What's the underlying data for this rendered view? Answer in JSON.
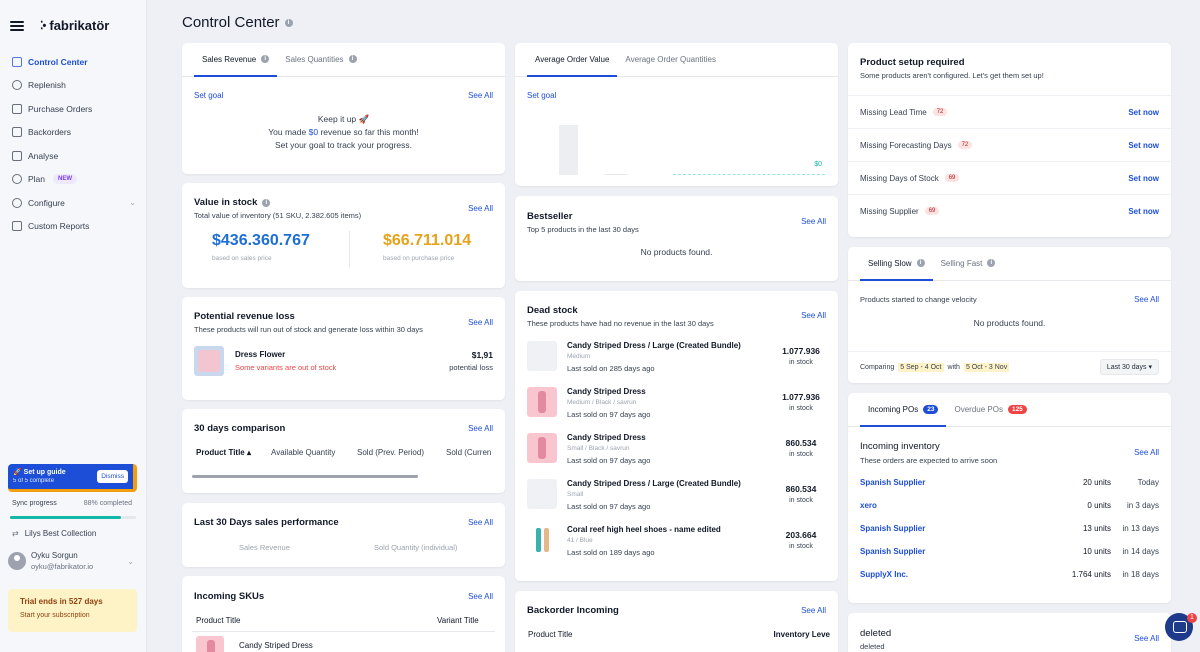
{
  "sidebar": {
    "brand": "fabrikatör",
    "items": [
      {
        "label": "Control Center",
        "active": true
      },
      {
        "label": "Replenish"
      },
      {
        "label": "Purchase Orders"
      },
      {
        "label": "Backorders"
      },
      {
        "label": "Analyse"
      },
      {
        "label": "Plan",
        "badge": "NEW"
      },
      {
        "label": "Configure"
      },
      {
        "label": "Custom Reports"
      }
    ],
    "setup_guide": {
      "title": "Set up guide",
      "subtitle": "5 of 5 complete",
      "dismiss": "Dismiss"
    },
    "sync": {
      "label": "Sync progress",
      "pct_text": "88% completed",
      "pct": 0.88
    },
    "store": "Lilys Best Collection",
    "user": {
      "name": "Oyku Sorgun",
      "email": "oyku@fabrikator.io"
    },
    "trial": {
      "title": "Trial ends in 527 days",
      "cta": "Start your subscription"
    }
  },
  "page": {
    "title": "Control Center"
  },
  "revenue": {
    "tabs": [
      "Sales Revenue",
      "Sales Quantities"
    ],
    "set_goal": "Set goal",
    "see_all": "See All",
    "line1": "Keep it up 🚀",
    "line2_pre": "You made ",
    "line2_val": "$0",
    "line2_post": " revenue so far this month!",
    "line3": "Set your goal to track your progress."
  },
  "value_stock": {
    "title": "Value in stock",
    "subtitle": "Total value of inventory (51 SKU, 2.382.605 items)",
    "see_all": "See All",
    "sales_value": "$436.360.767",
    "sales_caption": "based on sales price",
    "purchase_value": "$66.711.014",
    "purchase_caption": "based on purchase price"
  },
  "revenue_loss": {
    "title": "Potential revenue loss",
    "subtitle": "These products will run out of stock and generate loss within 30 days",
    "see_all": "See All",
    "product": "Dress Flower",
    "warning": "Some variants are out of stock",
    "amount": "$1,91",
    "amount_caption": "potential loss"
  },
  "comparison": {
    "title": "30 days comparison",
    "see_all": "See All",
    "columns": [
      "Product Title ▴",
      "Available Quantity",
      "Sold (Prev. Period)",
      "Sold (Curren"
    ]
  },
  "sales_perf": {
    "title": "Last 30 Days sales performance",
    "see_all": "See All",
    "legend": [
      "Sales Revenue",
      "Sold Quantity (individual)"
    ]
  },
  "incoming_skus": {
    "title": "Incoming SKUs",
    "see_all": "See All",
    "columns": [
      "Product Title",
      "Variant Title"
    ],
    "first_row": "Candy Striped Dress"
  },
  "aov": {
    "tabs": [
      "Average Order Value",
      "Average Order Quantities"
    ],
    "set_goal": "Set goal",
    "value_label": "$0"
  },
  "bestseller": {
    "title": "Bestseller",
    "subtitle": "Top 5 products in the last 30 days",
    "see_all": "See All",
    "empty": "No products found."
  },
  "dead_stock": {
    "title": "Dead stock",
    "subtitle": "These products have had no revenue in the last 30 days",
    "see_all": "See All",
    "in_stock": "in stock",
    "items": [
      {
        "name": "Candy Striped Dress / Large (Created Bundle)",
        "variant": "Medium",
        "last": "Last sold on 285 days ago",
        "qty": "1.077.936",
        "thumb": "blank"
      },
      {
        "name": "Candy Striped Dress",
        "variant": "Medium / Black / savrun",
        "last": "Last sold on 97 days ago",
        "qty": "1.077.936",
        "thumb": "pink"
      },
      {
        "name": "Candy Striped Dress",
        "variant": "Small / Black / savrun",
        "last": "Last sold on 97 days ago",
        "qty": "860.534",
        "thumb": "pink"
      },
      {
        "name": "Candy Striped Dress / Large (Created Bundle)",
        "variant": "Small",
        "last": "Last sold on 97 days ago",
        "qty": "860.534",
        "thumb": "blank"
      },
      {
        "name": "Coral reef high heel shoes - name edited",
        "variant": "41 / Blue",
        "last": "Last sold on 189 days ago",
        "qty": "203.664",
        "thumb": "shoe"
      }
    ]
  },
  "backorder": {
    "title": "Backorder Incoming",
    "see_all": "See All",
    "columns": [
      "Product Title",
      "Inventory Leve"
    ]
  },
  "setup_required": {
    "title": "Product setup required",
    "subtitle": "Some products aren't configured. Let's get them set up!",
    "set_now": "Set now",
    "rows": [
      {
        "label": "Missing Lead Time",
        "count": "72"
      },
      {
        "label": "Missing Forecasting Days",
        "count": "72"
      },
      {
        "label": "Missing Days of Stock",
        "count": "69"
      },
      {
        "label": "Missing Supplier",
        "count": "69"
      }
    ]
  },
  "velocity": {
    "tabs": [
      "Selling Slow",
      "Selling Fast"
    ],
    "subtitle": "Products started to change velocity",
    "see_all": "See All",
    "empty": "No products found.",
    "comparing": "Comparing",
    "range1": "5 Sep - 4 Oct",
    "with": "with",
    "range2": "5 Oct - 3 Nov",
    "period": "Last 30 days ▾"
  },
  "incoming_pos": {
    "tabs": [
      {
        "label": "Incoming POs",
        "count": "23",
        "color": "#1d4ed8"
      },
      {
        "label": "Overdue POs",
        "count": "125",
        "color": "#ef4444"
      }
    ],
    "title": "Incoming inventory",
    "subtitle": "These orders are expected to arrive soon",
    "see_all": "See All",
    "rows": [
      {
        "supplier": "Spanish Supplier",
        "units": "20 units",
        "days": "Today"
      },
      {
        "supplier": "xero",
        "units": "0 units",
        "days": "in 3 days"
      },
      {
        "supplier": "Spanish Supplier",
        "units": "13 units",
        "days": "in 13 days"
      },
      {
        "supplier": "Spanish Supplier",
        "units": "10 units",
        "days": "in 14 days"
      },
      {
        "supplier": "SupplyX Inc.",
        "units": "1.764 units",
        "days": "in 18 days"
      }
    ]
  },
  "deleted": {
    "title": "deleted",
    "subtitle": "deleted",
    "see_all": "See All"
  },
  "chat": {
    "badge": "1"
  }
}
